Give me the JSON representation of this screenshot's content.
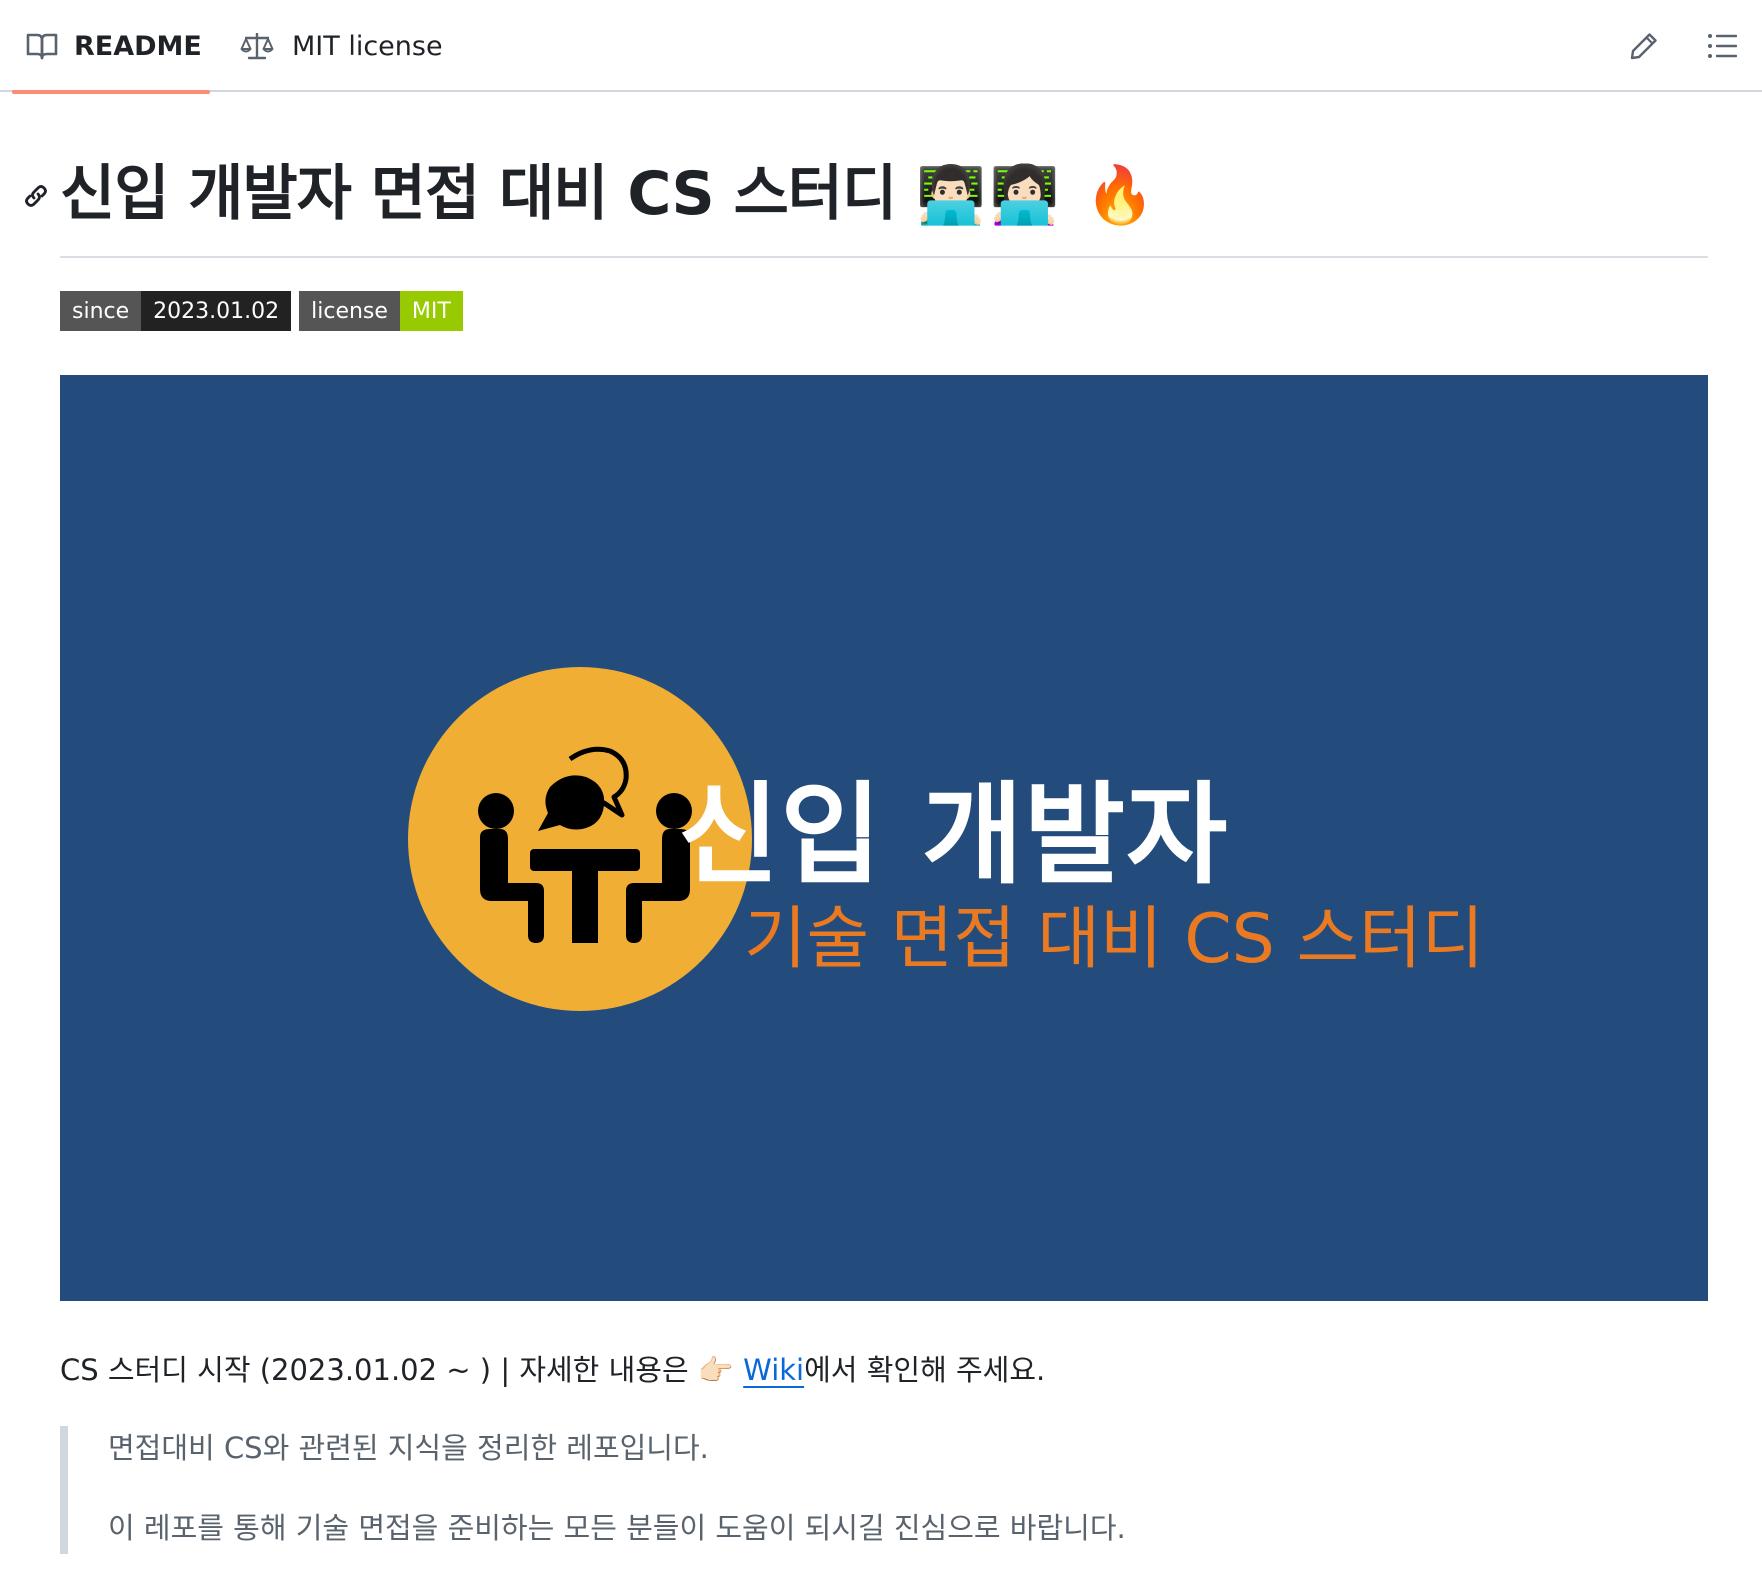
{
  "tabs": {
    "readme_label": "README",
    "license_label": "MIT license"
  },
  "toolbar": {
    "edit_icon": "pencil-icon",
    "outline_icon": "list-unordered-icon"
  },
  "heading": {
    "title_text": "신입 개발자 면접 대비 CS 스터디",
    "title_emojis": "👨🏻‍💻👩🏻‍💻 🔥",
    "anchor_icon": "link-icon"
  },
  "badges": [
    {
      "label": "since",
      "message": "2023.01.02",
      "color": "#222222"
    },
    {
      "label": "license",
      "message": "MIT",
      "color": "#97ca00"
    }
  ],
  "banner": {
    "title": "신입 개발자",
    "subtitle": "기술 면접 대비 CS 스터디",
    "background_color": "#234b7c",
    "circle_color": "#f0ae34",
    "subtitle_color": "#ea7a22",
    "icon": "meeting-discussion-icon"
  },
  "intro": {
    "prefix": "CS 스터디 시작 (2023.01.02 ~ ) | 자세한 내용은 ",
    "pointer_emoji": "👉🏻",
    "link_text": "Wiki",
    "suffix": "에서 확인해 주세요."
  },
  "quote": {
    "line1": "면접대비 CS와 관련된 지식을 정리한 레포입니다.",
    "line2": "이 레포를 통해 기술 면접을 준비하는 모든 분들이 도움이 되시길 진심으로 바랍니다."
  }
}
